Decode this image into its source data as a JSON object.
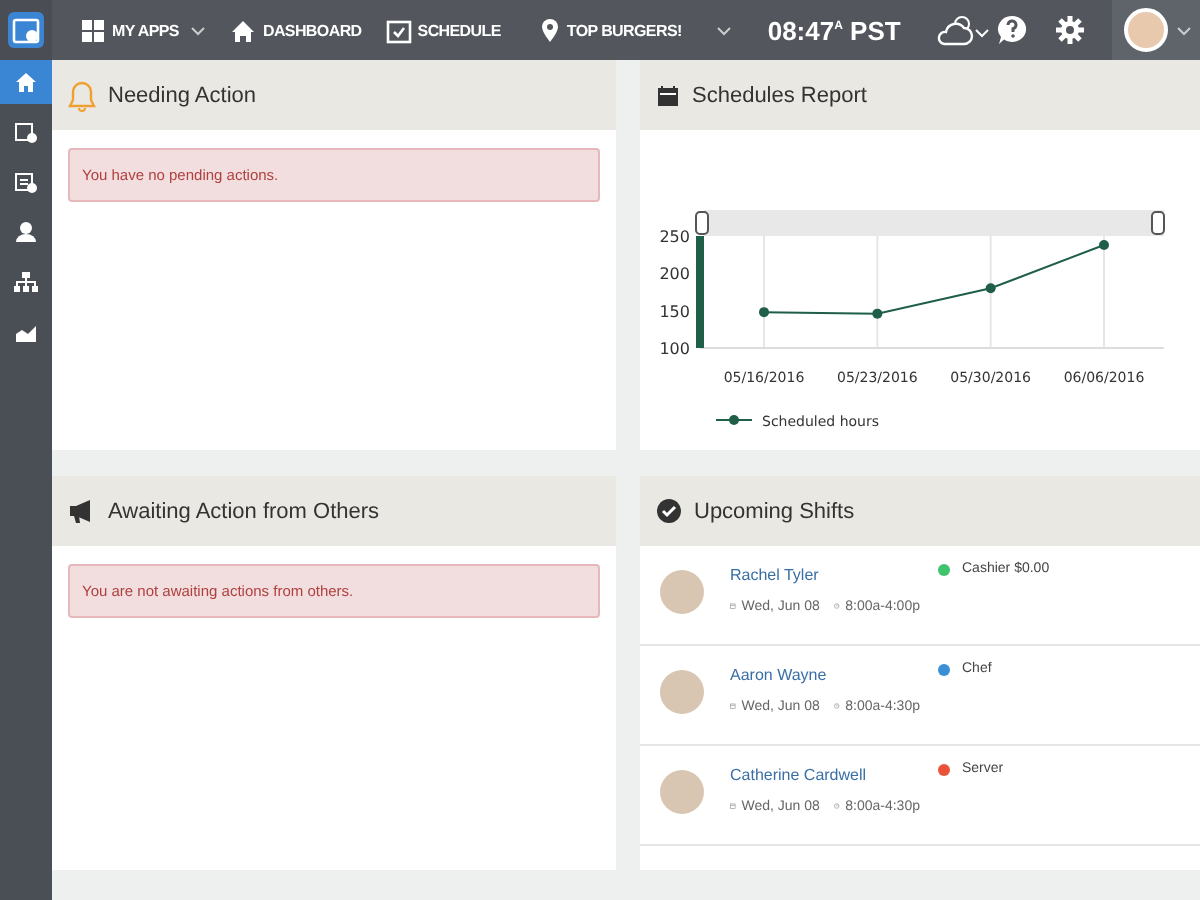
{
  "topbar": {
    "menu": [
      {
        "label": "MY APPS",
        "caret": true
      },
      {
        "label": "DASHBOARD",
        "caret": false
      },
      {
        "label": "SCHEDULE",
        "caret": false
      }
    ],
    "location": "TOP BURGERS!",
    "time": "08:47$^{A}$ PST"
  },
  "sidebar": {
    "items": [
      {
        "selected": true
      },
      {
        "selected": false
      },
      {
        "selected": false
      },
      {
        "selected": false
      },
      {
        "selected": false
      },
      {
        "selected": false
      }
    ]
  },
  "needing_action": {
    "title": "Needing Action",
    "message": "You have no pending actions."
  },
  "schedules_report": {
    "title": "Schedules Report",
    "chart_data": {
      "type": "line",
      "grid": true,
      "categories": [
        "05/16/2016",
        "05/23/2016",
        "05/30/2016",
        "06/06/2016"
      ],
      "series": [
        {
          "name": "Scheduled hours",
          "color": "#1f5f48",
          "marker": true,
          "values": [
            148,
            146,
            180,
            238
          ]
        }
      ],
      "ylim": [
        100,
        250
      ],
      "yticks": [
        100,
        150,
        200,
        250
      ]
    }
  },
  "awaiting_action": {
    "title": "Awaiting Action from Others",
    "message": "You are not awaiting actions from others."
  },
  "upcoming_shifts": {
    "title": "Upcoming Shifts",
    "shifts": [
      {
        "name": "Rachel Tyler",
        "date": "Wed, Jun 08",
        "time": "8:00a-4:00p",
        "role": "Cashier $0.00",
        "color": "#3ec46d"
      },
      {
        "name": "Aaron Wayne",
        "date": "Wed, Jun 08",
        "time": "8:00a-4:30p",
        "role": "Chef",
        "color": "#3b8fd4"
      },
      {
        "name": "Catherine Cardwell",
        "date": "Wed, Jun 08",
        "time": "8:00a-4:30p",
        "role": "Server",
        "color": "#e8533a"
      }
    ]
  }
}
